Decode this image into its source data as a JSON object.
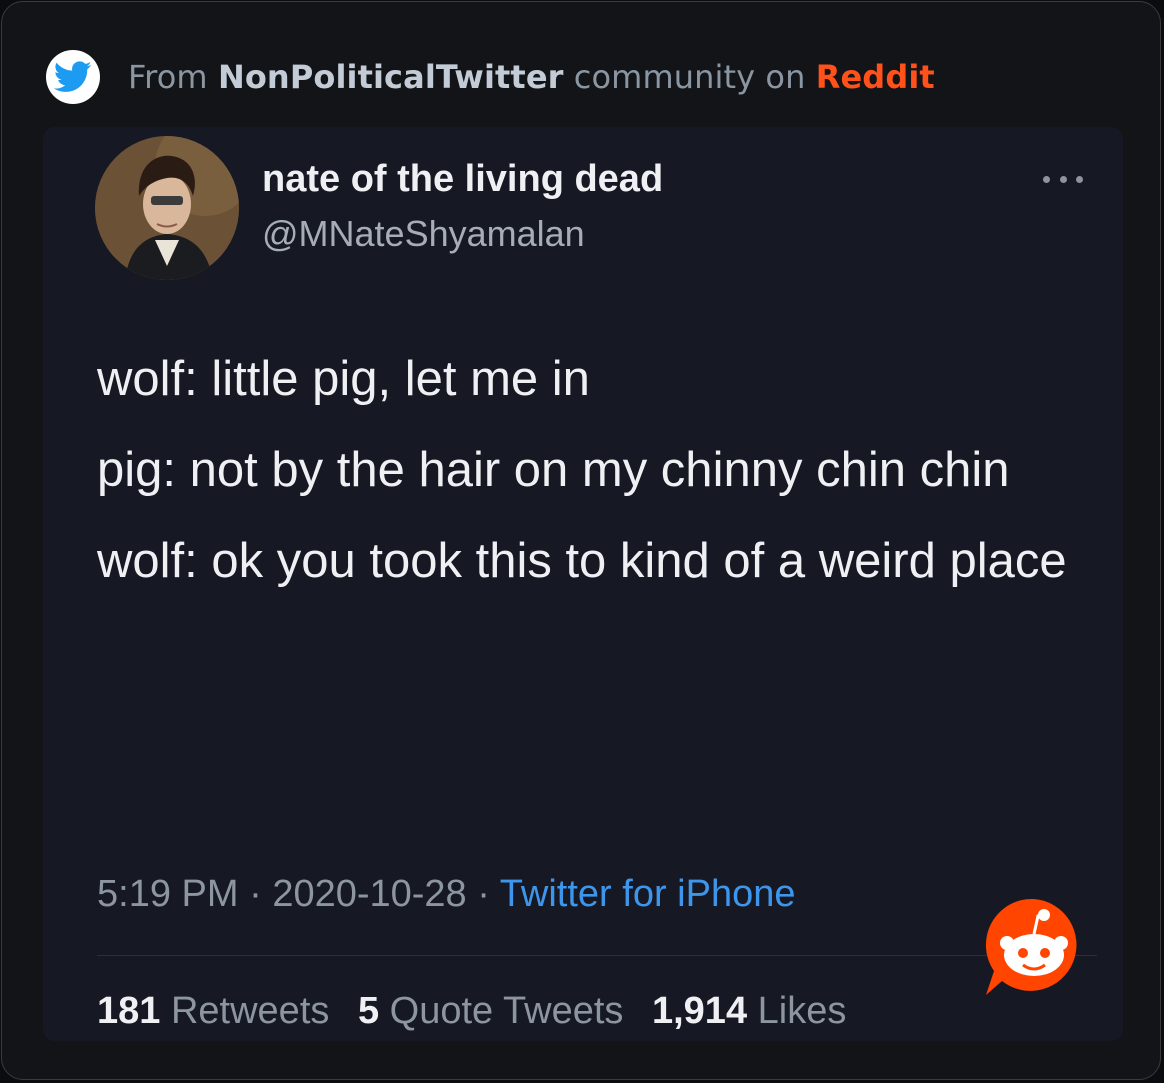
{
  "source": {
    "prefix": "From",
    "community": "NonPoliticalTwitter",
    "middle": "community on",
    "platform": "Reddit",
    "badge_icon": "twitter-bird-icon",
    "platform_color": "#ff5119"
  },
  "tweet": {
    "display_name": "nate of the living dead",
    "handle": "@MNateShyamalan",
    "lines": [
      "wolf: little pig, let me in",
      "pig: not by the hair on my chinny chin chin",
      "wolf: ok you took this to kind of a weird place"
    ],
    "time": "5:19 PM",
    "date": "2020-10-28",
    "separator": "·",
    "client": "Twitter for iPhone",
    "client_color": "#3d96ec"
  },
  "stats": {
    "retweets_count": "181",
    "retweets_label": "Retweets",
    "quotes_count": "5",
    "quotes_label": "Quote Tweets",
    "likes_count": "1,914",
    "likes_label": "Likes"
  },
  "icons": {
    "more": "more-options-icon",
    "watermark": "reddit-snoo-icon"
  }
}
